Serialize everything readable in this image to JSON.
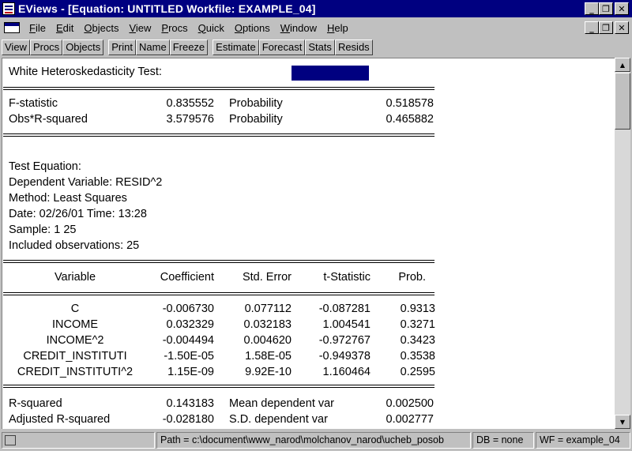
{
  "window": {
    "title": "EViews - [Equation: UNTITLED   Workfile: EXAMPLE_04]",
    "minimize_glyph": "_",
    "restore_glyph": "❐",
    "close_glyph": "✕"
  },
  "menu": {
    "items": [
      {
        "underline": "F",
        "rest": "ile"
      },
      {
        "underline": "E",
        "rest": "dit"
      },
      {
        "underline": "O",
        "rest": "bjects"
      },
      {
        "underline": "V",
        "rest": "iew"
      },
      {
        "underline": "P",
        "rest": "rocs"
      },
      {
        "underline": "Q",
        "rest": "uick"
      },
      {
        "underline": "O",
        "rest": "ptions"
      },
      {
        "underline": "W",
        "rest": "indow"
      },
      {
        "underline": "H",
        "rest": "elp"
      }
    ]
  },
  "toolbar": {
    "group1": [
      "View",
      "Procs",
      "Objects"
    ],
    "group2": [
      "Print",
      "Name",
      "Freeze"
    ],
    "group3": [
      "Estimate",
      "Forecast",
      "Stats",
      "Resids"
    ]
  },
  "report": {
    "heading": "White Heteroskedasticity Test:",
    "tests": [
      {
        "label": "F-statistic",
        "value": "0.835552",
        "plabel": "Probability",
        "pvalue": "0.518578"
      },
      {
        "label": "Obs*R-squared",
        "value": "3.579576",
        "plabel": "Probability",
        "pvalue": "0.465882"
      }
    ],
    "info": [
      "Test Equation:",
      "Dependent Variable: RESID^2",
      "Method: Least Squares",
      "Date: 02/26/01   Time: 13:28",
      "Sample: 1 25",
      "Included observations: 25"
    ],
    "columns": [
      "Variable",
      "Coefficient",
      "Std. Error",
      "t-Statistic",
      "Prob."
    ],
    "rows": [
      {
        "var": "C",
        "coef": "-0.006730",
        "se": "0.077112",
        "t": "-0.087281",
        "p": "0.9313"
      },
      {
        "var": "INCOME",
        "coef": "0.032329",
        "se": "0.032183",
        "t": "1.004541",
        "p": "0.3271"
      },
      {
        "var": "INCOME^2",
        "coef": "-0.004494",
        "se": "0.004620",
        "t": "-0.972767",
        "p": "0.3423"
      },
      {
        "var": "CREDIT_INSTITUTI",
        "coef": "-1.50E-05",
        "se": "1.58E-05",
        "t": "-0.949378",
        "p": "0.3538"
      },
      {
        "var": "CREDIT_INSTITUTI^2",
        "coef": "1.15E-09",
        "se": "9.92E-10",
        "t": "1.160464",
        "p": "0.2595"
      }
    ],
    "stats": [
      {
        "label": "R-squared",
        "value": "0.143183",
        "label2": "Mean dependent var",
        "value2": "0.002500"
      },
      {
        "label": "Adjusted R-squared",
        "value": "-0.028180",
        "label2": "S.D. dependent var",
        "value2": "0.002777"
      }
    ]
  },
  "scrollbar": {
    "up_glyph": "▲",
    "down_glyph": "▼"
  },
  "status": {
    "path": "Path = c:\\document\\www_narod\\molchanov_narod\\ucheb_posob",
    "db": "DB = none",
    "wf": "WF = example_04"
  },
  "colors": {
    "titlebar": "#000080",
    "progress": "#000080",
    "face": "#c0c0c0"
  }
}
